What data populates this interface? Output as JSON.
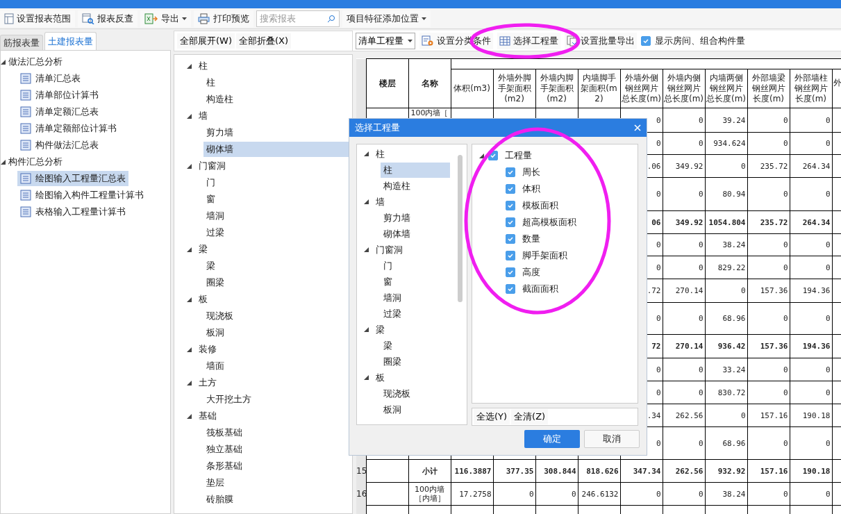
{
  "toolbar": {
    "buttons": [
      {
        "label": "设置报表范围",
        "has_menu": false
      },
      {
        "label": "报表反查",
        "has_menu": false
      },
      {
        "label": "导出",
        "has_menu": true
      },
      {
        "label": "打印预览",
        "has_menu": false
      }
    ],
    "search": {
      "placeholder": "搜索报表"
    },
    "position_menu": {
      "label": "项目特征添加位置"
    }
  },
  "left_panel": {
    "tabs": [
      {
        "label": "筋报表量",
        "selected": false
      },
      {
        "label": "土建报表量",
        "selected": true
      }
    ],
    "tree": [
      {
        "label": "做法汇总分析",
        "expanded": true,
        "children": [
          {
            "label": "清单汇总表",
            "selected": false
          },
          {
            "label": "清单部位计算书",
            "selected": false
          },
          {
            "label": "清单定额汇总表",
            "selected": false
          },
          {
            "label": "清单定额部位计算书",
            "selected": false
          },
          {
            "label": "构件做法汇总表",
            "selected": false
          }
        ]
      },
      {
        "label": "构件汇总分析",
        "expanded": true,
        "children": [
          {
            "label": "绘图输入工程量汇总表",
            "selected": true
          },
          {
            "label": "绘图输入构件工程量计算书",
            "selected": false
          },
          {
            "label": "表格输入工程量计算书",
            "selected": false
          }
        ]
      }
    ]
  },
  "middle_panel": {
    "buttons": [
      "全部展开(W)",
      "全部折叠(X)"
    ],
    "tree": [
      {
        "label": "柱",
        "expanded": true,
        "children": [
          {
            "label": "柱",
            "selected": false
          },
          {
            "label": "构造柱",
            "selected": false
          }
        ]
      },
      {
        "label": "墙",
        "expanded": true,
        "children": [
          {
            "label": "剪力墙",
            "selected": false
          },
          {
            "label": "砌体墙",
            "selected": true
          }
        ]
      },
      {
        "label": "门窗洞",
        "expanded": true,
        "children": [
          {
            "label": "门",
            "selected": false
          },
          {
            "label": "窗",
            "selected": false
          },
          {
            "label": "墙洞",
            "selected": false
          },
          {
            "label": "过梁",
            "selected": false
          }
        ]
      },
      {
        "label": "梁",
        "expanded": true,
        "children": [
          {
            "label": "梁",
            "selected": false
          },
          {
            "label": "圈梁",
            "selected": false
          }
        ]
      },
      {
        "label": "板",
        "expanded": true,
        "children": [
          {
            "label": "现浇板",
            "selected": false
          },
          {
            "label": "板洞",
            "selected": false
          }
        ]
      },
      {
        "label": "装修",
        "expanded": true,
        "children": [
          {
            "label": "墙面",
            "selected": false
          }
        ]
      },
      {
        "label": "土方",
        "expanded": true,
        "children": [
          {
            "label": "大开挖土方",
            "selected": false
          }
        ]
      },
      {
        "label": "基础",
        "expanded": true,
        "children": [
          {
            "label": "筏板基础",
            "selected": false
          },
          {
            "label": "独立基础",
            "selected": false
          },
          {
            "label": "条形基础",
            "selected": false
          },
          {
            "label": "垫层",
            "selected": false
          },
          {
            "label": "砖胎膜",
            "selected": false
          }
        ]
      }
    ]
  },
  "report": {
    "toolbar": {
      "quantity_type": "清单工程量",
      "buttons": [
        "设置分类条件",
        "选择工程量",
        "设置批量导出"
      ],
      "show_rooms": {
        "label": "显示房间、组合构件量",
        "checked": true
      }
    },
    "table": {
      "columns": [
        "楼层",
        "名称",
        "体积(m3)",
        "外墙外脚手架面积(m2)",
        "外墙内脚手架面积(m2)",
        "内墙脚手架面积(m2)",
        "外墙外侧钢丝网片总长度(m)",
        "外墙内侧钢丝网片总长度(m)",
        "内墙两侧钢丝网片总长度(m)",
        "外部墙梁钢丝网片长度(m)",
        "外部墙柱钢丝网片长度(m)",
        "外"
      ],
      "rows": [
        {
          "name": "100内墙［",
          "subtotal": false,
          "values": [
            "0",
            "0",
            "39.24",
            "0",
            "0"
          ]
        },
        {
          "subtotal": false,
          "values": [
            "0",
            "0",
            "934.624",
            "0",
            "0"
          ]
        },
        {
          "subtotal": false,
          "values": [
            ".06",
            "349.92",
            "0",
            "235.72",
            "264.34"
          ]
        },
        {
          "subtotal": false,
          "values": [
            "0",
            "0",
            "80.94",
            "0",
            "0"
          ]
        },
        {
          "subtotal": true,
          "values": [
            "06",
            "349.92",
            "1054.804",
            "235.72",
            "264.34"
          ]
        },
        {
          "subtotal": false,
          "values": [
            "0",
            "0",
            "38.24",
            "0",
            "0"
          ]
        },
        {
          "subtotal": false,
          "values": [
            "0",
            "0",
            "829.22",
            "0",
            "0"
          ]
        },
        {
          "subtotal": false,
          "values": [
            ".72",
            "270.14",
            "0",
            "157.36",
            "194.36"
          ]
        },
        {
          "subtotal": false,
          "values": [
            "0",
            "0",
            "68.96",
            "0",
            "0"
          ]
        },
        {
          "subtotal": true,
          "values": [
            "72",
            "270.14",
            "936.42",
            "157.36",
            "194.36"
          ]
        },
        {
          "subtotal": false,
          "values": [
            "0",
            "0",
            "33.24",
            "0",
            "0"
          ]
        },
        {
          "subtotal": false,
          "values": [
            "0",
            "0",
            "830.72",
            "0",
            "0"
          ]
        },
        {
          "subtotal": false,
          "values": [
            ".34",
            "262.56",
            "0",
            "157.16",
            "190.18"
          ]
        },
        {
          "subtotal": false,
          "values": [
            "0",
            "0",
            "68.96",
            "0",
            "0"
          ]
        },
        {
          "row_number": "15",
          "name": "小计",
          "subtotal": true,
          "values": [
            "116.3887",
            "377.35",
            "308.844",
            "818.626",
            "347.34",
            "262.56",
            "932.92",
            "157.16",
            "190.18"
          ]
        },
        {
          "row_number": "16",
          "name": "100内墙［内墙］",
          "subtotal": false,
          "values": [
            "17.2758",
            "0",
            "0",
            "246.6132",
            "0",
            "0",
            "38.24",
            "0",
            "0"
          ]
        }
      ]
    }
  },
  "dialog": {
    "title": "选择工程量",
    "tree": [
      {
        "label": "柱",
        "expanded": true,
        "children": [
          {
            "label": "柱",
            "selected": true
          },
          {
            "label": "构造柱",
            "selected": false
          }
        ]
      },
      {
        "label": "墙",
        "expanded": true,
        "children": [
          {
            "label": "剪力墙",
            "selected": false
          },
          {
            "label": "砌体墙",
            "selected": false
          }
        ]
      },
      {
        "label": "门窗洞",
        "expanded": true,
        "children": [
          {
            "label": "门",
            "selected": false
          },
          {
            "label": "窗",
            "selected": false
          },
          {
            "label": "墙洞",
            "selected": false
          },
          {
            "label": "过梁",
            "selected": false
          }
        ]
      },
      {
        "label": "梁",
        "expanded": true,
        "children": [
          {
            "label": "梁",
            "selected": false
          },
          {
            "label": "圈梁",
            "selected": false
          }
        ]
      },
      {
        "label": "板",
        "expanded": true,
        "children": [
          {
            "label": "现浇板",
            "selected": false
          },
          {
            "label": "板洞",
            "selected": false
          }
        ]
      }
    ],
    "quantities": {
      "label": "工程量",
      "checked": true,
      "expanded": true,
      "children": [
        {
          "label": "周长",
          "checked": true
        },
        {
          "label": "体积",
          "checked": true
        },
        {
          "label": "模板面积",
          "checked": true
        },
        {
          "label": "超高模板面积",
          "checked": true
        },
        {
          "label": "数量",
          "checked": true
        },
        {
          "label": "脚手架面积",
          "checked": true
        },
        {
          "label": "高度",
          "checked": true
        },
        {
          "label": "截面面积",
          "checked": true
        }
      ]
    },
    "select_buttons": [
      "全选(Y)",
      "全清(Z)"
    ],
    "ok": "确定",
    "cancel": "取消"
  }
}
